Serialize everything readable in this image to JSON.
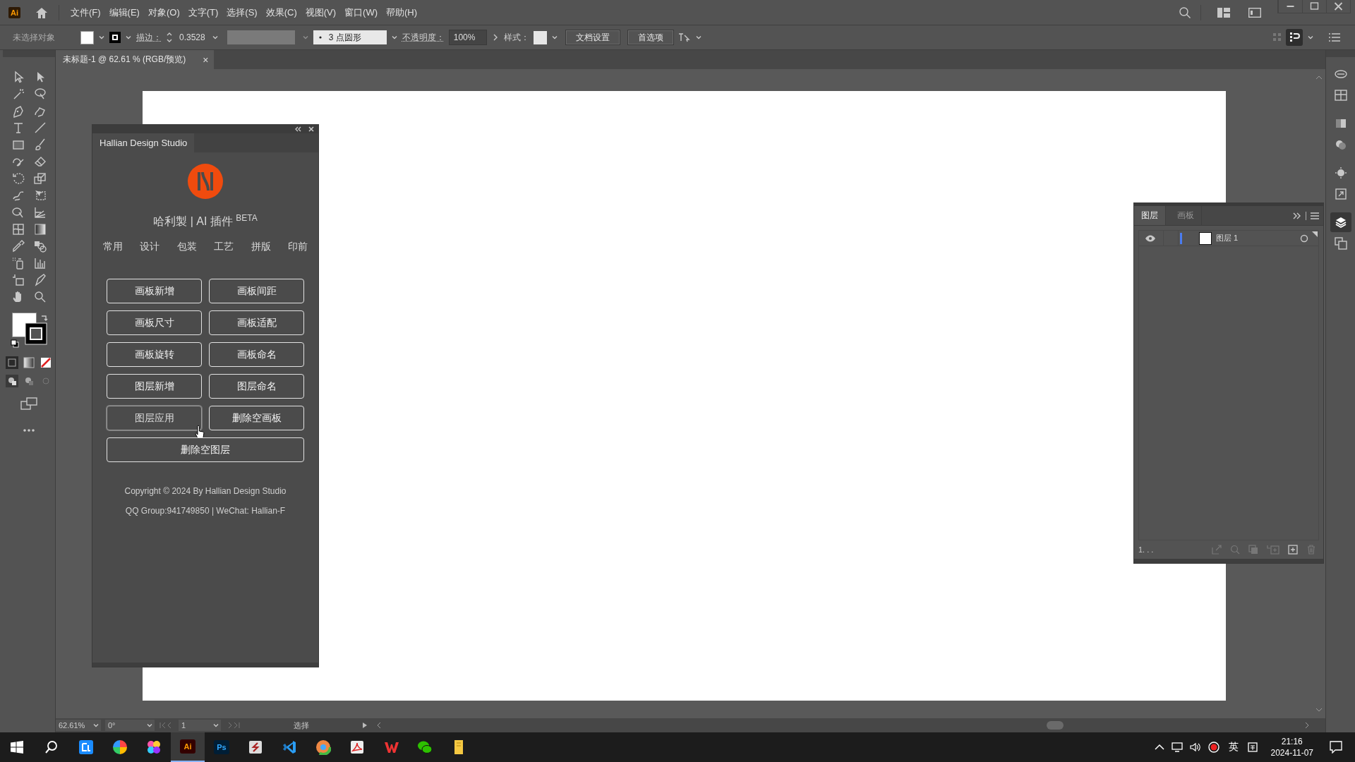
{
  "app_bar": {
    "logo": "Ai",
    "menus": [
      "文件(F)",
      "编辑(E)",
      "对象(O)",
      "文字(T)",
      "选择(S)",
      "效果(C)",
      "视图(V)",
      "窗口(W)",
      "帮助(H)"
    ]
  },
  "control_bar": {
    "selection": "未选择对象",
    "stroke_label": "描边：",
    "stroke_value": "0.3528",
    "brush": "3 点圆形",
    "opacity_label": "不透明度：",
    "opacity_value": "100%",
    "style_label": "样式：",
    "buttons": [
      "文档设置",
      "首选项"
    ]
  },
  "document_tab": {
    "title": "未标题-1 @ 62.61 % (RGB/预览)",
    "close": "×"
  },
  "plugin_panel": {
    "tab": "Hallian Design Studio",
    "title": "哈利製 | AI 插件 $^{BETA}$",
    "categories": [
      "常用",
      "设计",
      "包装",
      "工艺",
      "拼版",
      "印前"
    ],
    "buttons": [
      {
        "label": "画板新增",
        "wide": false,
        "hovered": false
      },
      {
        "label": "画板间距",
        "wide": false,
        "hovered": false
      },
      {
        "label": "画板尺寸",
        "wide": false,
        "hovered": false
      },
      {
        "label": "画板适配",
        "wide": false,
        "hovered": false
      },
      {
        "label": "画板旋转",
        "wide": false,
        "hovered": false
      },
      {
        "label": "画板命名",
        "wide": false,
        "hovered": false
      },
      {
        "label": "图层新增",
        "wide": false,
        "hovered": false
      },
      {
        "label": "图层命名",
        "wide": false,
        "hovered": false
      },
      {
        "label": "图层应用",
        "wide": false,
        "hovered": true
      },
      {
        "label": "删除空画板",
        "wide": false,
        "hovered": false
      },
      {
        "label": "删除空图层",
        "wide": true,
        "hovered": false
      }
    ],
    "copyright": "Copyright © 2024 By Hallian Design Studio",
    "contact": "QQ Group:941749850 | WeChat: Hallian-F"
  },
  "layers_panel": {
    "tabs": [
      {
        "label": "图层",
        "selected": true
      },
      {
        "label": "画板",
        "selected": false
      }
    ],
    "layers": [
      {
        "name": "图层 1",
        "visible": true,
        "color": "#4a7cf0"
      }
    ],
    "footer": "1. . ."
  },
  "dock_icons": [
    {
      "selected": false
    },
    {
      "selected": false
    },
    {
      "selected": false
    },
    {
      "selected": false
    },
    {
      "selected": false
    },
    {
      "selected": false
    },
    {
      "selected": true
    },
    {
      "selected": false
    }
  ],
  "status_bar": {
    "zoom": "62.61%",
    "rotation": "0°",
    "artboard": "1",
    "tool": "选择"
  },
  "taskbar": {
    "apps": [
      {
        "kind": "blue"
      },
      {
        "kind": "pinwheel"
      },
      {
        "kind": "dots"
      },
      {
        "kind": "ai",
        "label": "Ai",
        "active": true
      },
      {
        "kind": "ps",
        "label": "Ps",
        "active": false
      },
      {
        "kind": "sapp"
      },
      {
        "kind": "vscode"
      },
      {
        "kind": "chrome"
      },
      {
        "kind": "pdf"
      },
      {
        "kind": "wps"
      },
      {
        "kind": "wechat"
      },
      {
        "kind": "notes"
      }
    ],
    "ime": "英",
    "time": "21:16",
    "date": "2024-11-07"
  }
}
